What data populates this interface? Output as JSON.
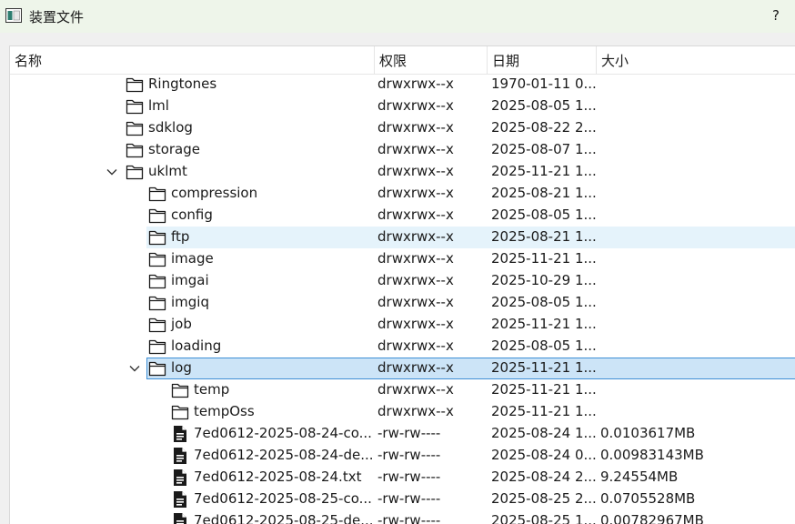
{
  "window": {
    "title": "装置文件",
    "help": "?"
  },
  "columns": {
    "name": "名称",
    "perm": "权限",
    "date": "日期",
    "size": "大小"
  },
  "rows": [
    {
      "name": "Ringtones",
      "perm": "drwxrwx--x",
      "date": "1970-01-11 0...",
      "size": "",
      "type": "folder",
      "depth": 0,
      "expand": "",
      "state": ""
    },
    {
      "name": "lml",
      "perm": "drwxrwx--x",
      "date": "2025-08-05 1...",
      "size": "",
      "type": "folder",
      "depth": 0,
      "expand": "",
      "state": ""
    },
    {
      "name": "sdklog",
      "perm": "drwxrwx--x",
      "date": "2025-08-22 2...",
      "size": "",
      "type": "folder",
      "depth": 0,
      "expand": "",
      "state": ""
    },
    {
      "name": "storage",
      "perm": "drwxrwx--x",
      "date": "2025-08-07 1...",
      "size": "",
      "type": "folder",
      "depth": 0,
      "expand": "",
      "state": ""
    },
    {
      "name": "uklmt",
      "perm": "drwxrwx--x",
      "date": "2025-11-21 1...",
      "size": "",
      "type": "folder",
      "depth": 0,
      "expand": "expanded",
      "state": ""
    },
    {
      "name": "compression",
      "perm": "drwxrwx--x",
      "date": "2025-08-21 1...",
      "size": "",
      "type": "folder",
      "depth": 1,
      "expand": "",
      "state": ""
    },
    {
      "name": "config",
      "perm": "drwxrwx--x",
      "date": "2025-08-05 1...",
      "size": "",
      "type": "folder",
      "depth": 1,
      "expand": "",
      "state": ""
    },
    {
      "name": "ftp",
      "perm": "drwxrwx--x",
      "date": "2025-08-21 1...",
      "size": "",
      "type": "folder",
      "depth": 1,
      "expand": "",
      "state": "hover"
    },
    {
      "name": "image",
      "perm": "drwxrwx--x",
      "date": "2025-11-21 1...",
      "size": "",
      "type": "folder",
      "depth": 1,
      "expand": "",
      "state": ""
    },
    {
      "name": "imgai",
      "perm": "drwxrwx--x",
      "date": "2025-10-29 1...",
      "size": "",
      "type": "folder",
      "depth": 1,
      "expand": "",
      "state": ""
    },
    {
      "name": "imgiq",
      "perm": "drwxrwx--x",
      "date": "2025-08-05 1...",
      "size": "",
      "type": "folder",
      "depth": 1,
      "expand": "",
      "state": ""
    },
    {
      "name": "job",
      "perm": "drwxrwx--x",
      "date": "2025-11-21 1...",
      "size": "",
      "type": "folder",
      "depth": 1,
      "expand": "",
      "state": ""
    },
    {
      "name": "loading",
      "perm": "drwxrwx--x",
      "date": "2025-08-05 1...",
      "size": "",
      "type": "folder",
      "depth": 1,
      "expand": "",
      "state": ""
    },
    {
      "name": "log",
      "perm": "drwxrwx--x",
      "date": "2025-11-21 1...",
      "size": "",
      "type": "folder",
      "depth": 1,
      "expand": "expanded",
      "state": "selected"
    },
    {
      "name": "temp",
      "perm": "drwxrwx--x",
      "date": "2025-11-21 1...",
      "size": "",
      "type": "folder",
      "depth": 2,
      "expand": "",
      "state": ""
    },
    {
      "name": "tempOss",
      "perm": "drwxrwx--x",
      "date": "2025-11-21 1...",
      "size": "",
      "type": "folder",
      "depth": 2,
      "expand": "",
      "state": ""
    },
    {
      "name": "7ed0612-2025-08-24-co...",
      "perm": "-rw-rw----",
      "date": "2025-08-24 1...",
      "size": "0.0103617MB",
      "type": "file",
      "depth": 2,
      "expand": "",
      "state": ""
    },
    {
      "name": "7ed0612-2025-08-24-de...",
      "perm": "-rw-rw----",
      "date": "2025-08-24 0...",
      "size": "0.00983143MB",
      "type": "file",
      "depth": 2,
      "expand": "",
      "state": ""
    },
    {
      "name": "7ed0612-2025-08-24.txt",
      "perm": "-rw-rw----",
      "date": "2025-08-24 2...",
      "size": "9.24554MB",
      "type": "file",
      "depth": 2,
      "expand": "",
      "state": ""
    },
    {
      "name": "7ed0612-2025-08-25-co...",
      "perm": "-rw-rw----",
      "date": "2025-08-25 2...",
      "size": "0.0705528MB",
      "type": "file",
      "depth": 2,
      "expand": "",
      "state": ""
    },
    {
      "name": "7ed0612-2025-08-25-de...",
      "perm": "-rw-rw----",
      "date": "2025-08-25 1...",
      "size": "0.00782967MB",
      "type": "file",
      "depth": 2,
      "expand": "",
      "state": ""
    }
  ]
}
